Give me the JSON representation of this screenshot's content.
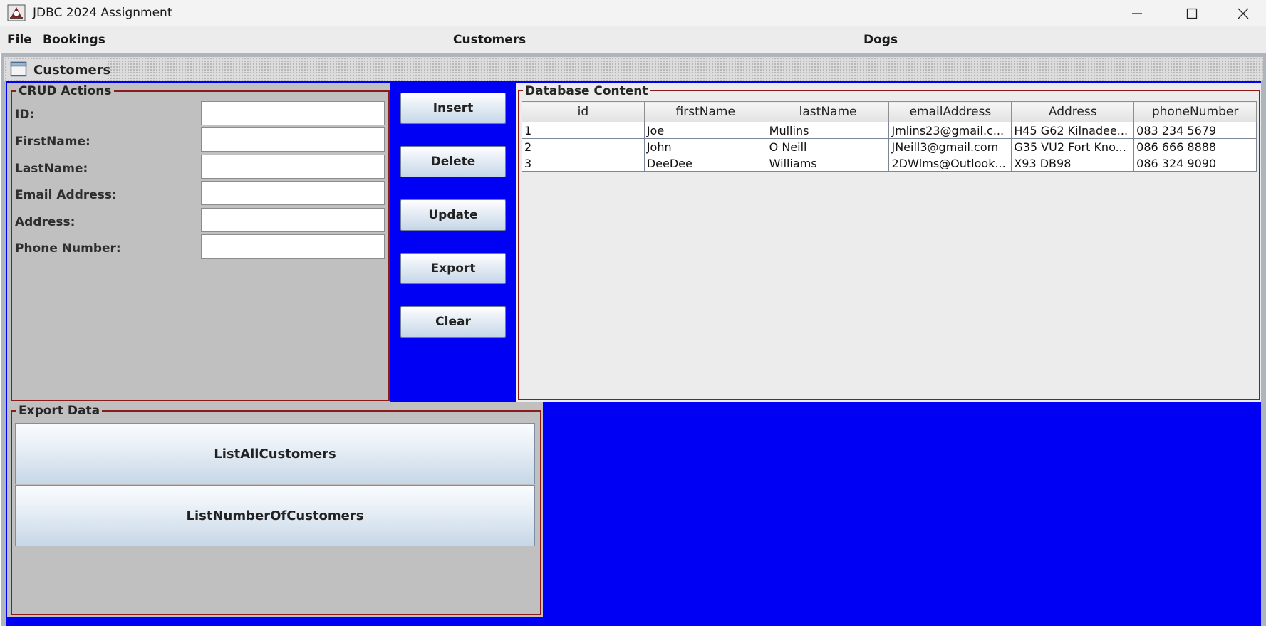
{
  "window": {
    "title": "JDBC 2024 Assignment",
    "controls": [
      "minimize",
      "maximize",
      "close"
    ]
  },
  "menu": {
    "file": "File",
    "bookings": "Bookings",
    "customers": "Customers",
    "dogs": "Dogs"
  },
  "frame": {
    "title": "Customers"
  },
  "crud": {
    "title": "CRUD Actions",
    "labels": {
      "id": "ID:",
      "first_name": "FirstName:",
      "last_name": "LastName:",
      "email": "Email Address:",
      "address": "Address:",
      "phone": "Phone Number:"
    },
    "values": {
      "id": "",
      "first_name": "",
      "last_name": "",
      "email": "",
      "address": "",
      "phone": ""
    }
  },
  "actions": {
    "insert": "Insert",
    "delete": "Delete",
    "update": "Update",
    "export": "Export",
    "clear": "Clear"
  },
  "database": {
    "title": "Database Content",
    "columns": [
      "id",
      "firstName",
      "lastName",
      "emailAddress",
      "Address",
      "phoneNumber"
    ],
    "rows": [
      [
        "1",
        "Joe",
        "Mullins",
        "Jmlins23@gmail.c...",
        "H45 G62 Kilnadee...",
        "083 234 5679"
      ],
      [
        "2",
        "John",
        "O Neill",
        "JNeill3@gmail.com",
        "G35 VU2 Fort Kno...",
        "086 666 8888"
      ],
      [
        "3",
        "DeeDee",
        "Williams",
        "2DWlms@Outlook...",
        "X93 DB98",
        "086 324 9090"
      ]
    ]
  },
  "export_data": {
    "title": "Export Data",
    "list_all": "ListAllCustomers",
    "list_number": "ListNumberOfCustomers"
  },
  "colors": {
    "content_bg": "#0000f5",
    "panel_bg": "#c0c0c0",
    "groupbox_border": "#8c1a1a"
  }
}
